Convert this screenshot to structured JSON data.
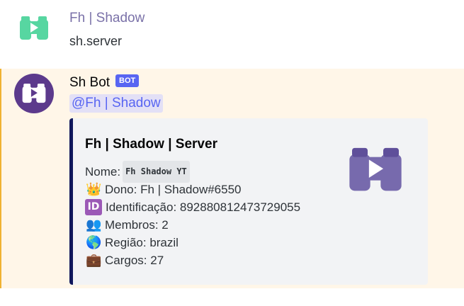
{
  "messages": [
    {
      "author": "Fh | Shadow",
      "content": "sh.server",
      "avatar_icon": "binoculars-play-icon",
      "avatar_color": "#57d6a1"
    },
    {
      "author": "Sh Bot",
      "badge": "BOT",
      "mention": "@Fh | Shadow",
      "avatar_icon": "binoculars-play-icon",
      "avatar_bg": "#5c3a8c",
      "embed": {
        "title": "Fh | Shadow | Server",
        "accent_color": "#10175c",
        "thumbnail_icon": "binoculars-play-icon",
        "thumbnail_color": "#776aad",
        "fields": {
          "name_label": "Nome:",
          "name_value": "Fh Shadow YT",
          "owner": "Dono: Fh | Shadow#6550",
          "id_emoji": "ID",
          "id": "Identificação: 892880812473729055",
          "members": "Membros: 2",
          "region": "Região: brazil",
          "roles": "Cargos: 27"
        },
        "emojis": {
          "owner": "👑",
          "members": "👥",
          "region": "🌎",
          "roles": "💼"
        }
      }
    }
  ],
  "colors": {
    "mention_highlight": "#fff6e8",
    "mention_bar": "#f0b232",
    "bot_badge": "#5865f2"
  }
}
